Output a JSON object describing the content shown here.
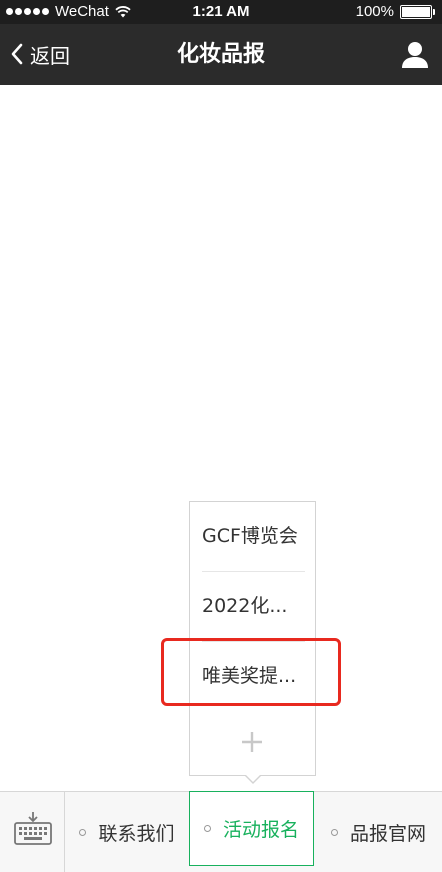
{
  "status_bar": {
    "carrier": "WeChat",
    "time": "1:21 AM",
    "battery": "100%",
    "battery_level": 1.0
  },
  "nav": {
    "back_label": "返回",
    "title": "化妆品报"
  },
  "submenu": {
    "items": [
      "GCF博览会",
      "2022化...",
      "唯美奖提..."
    ],
    "add_icon": "plus-icon"
  },
  "bottom_menu": {
    "tabs": [
      "联系我们",
      "活动报名",
      "品报官网"
    ],
    "active_tab": "活动报名"
  },
  "colors": {
    "status_bg": "#1e1e1e",
    "nav_bg": "#2b2b2b",
    "accent_green": "#18b15d",
    "highlight_red": "#e8291f"
  }
}
